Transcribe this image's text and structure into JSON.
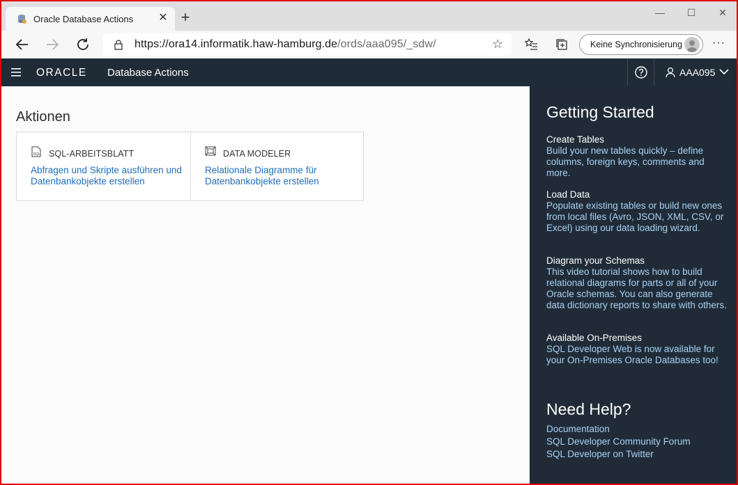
{
  "browser": {
    "tab_title": "Oracle Database Actions",
    "url_main": "https://ora14.informatik.haw-hamburg.de",
    "url_rest": "/ords/aaa095/_sdw/",
    "sync_label": "Keine Synchronisierung"
  },
  "app": {
    "brand": "ORACLE",
    "title": "Database Actions",
    "user": "AAA095"
  },
  "main": {
    "title": "Aktionen",
    "cards": [
      {
        "title": "SQL-ARBEITSBLATT",
        "description": "Abfragen und Skripte ausführen und Datenbankobjekte erstellen"
      },
      {
        "title": "DATA MODELER",
        "description": "Relationale Diagramme für Datenbankobjekte erstellen"
      }
    ]
  },
  "getting_started": {
    "title": "Getting Started",
    "sections": [
      {
        "title": "Create Tables",
        "text": "Build your new tables quickly – define columns, foreign keys, comments and more."
      },
      {
        "title": "Load Data",
        "text": "Populate existing tables or build new ones from local files (Avro, JSON, XML, CSV, or Excel) using our data loading wizard."
      },
      {
        "title": "Diagram your Schemas",
        "text": "This video tutorial shows how to build relational diagrams for parts or all of your Oracle schemas. You can also generate data dictionary reports to share with others."
      },
      {
        "title": "Available On-Premises",
        "text": "SQL Developer Web is now available for your On-Premises Oracle Databases too!"
      }
    ]
  },
  "need_help": {
    "title": "Need Help?",
    "links": [
      "Documentation",
      "SQL Developer Community Forum",
      "SQL Developer on Twitter"
    ]
  },
  "colors": {
    "header_bg": "#1f2b36",
    "panel_bg": "#202b37",
    "link": "#1f6dbb",
    "panel_link": "#a9d2f5",
    "frame": "#e00000"
  }
}
